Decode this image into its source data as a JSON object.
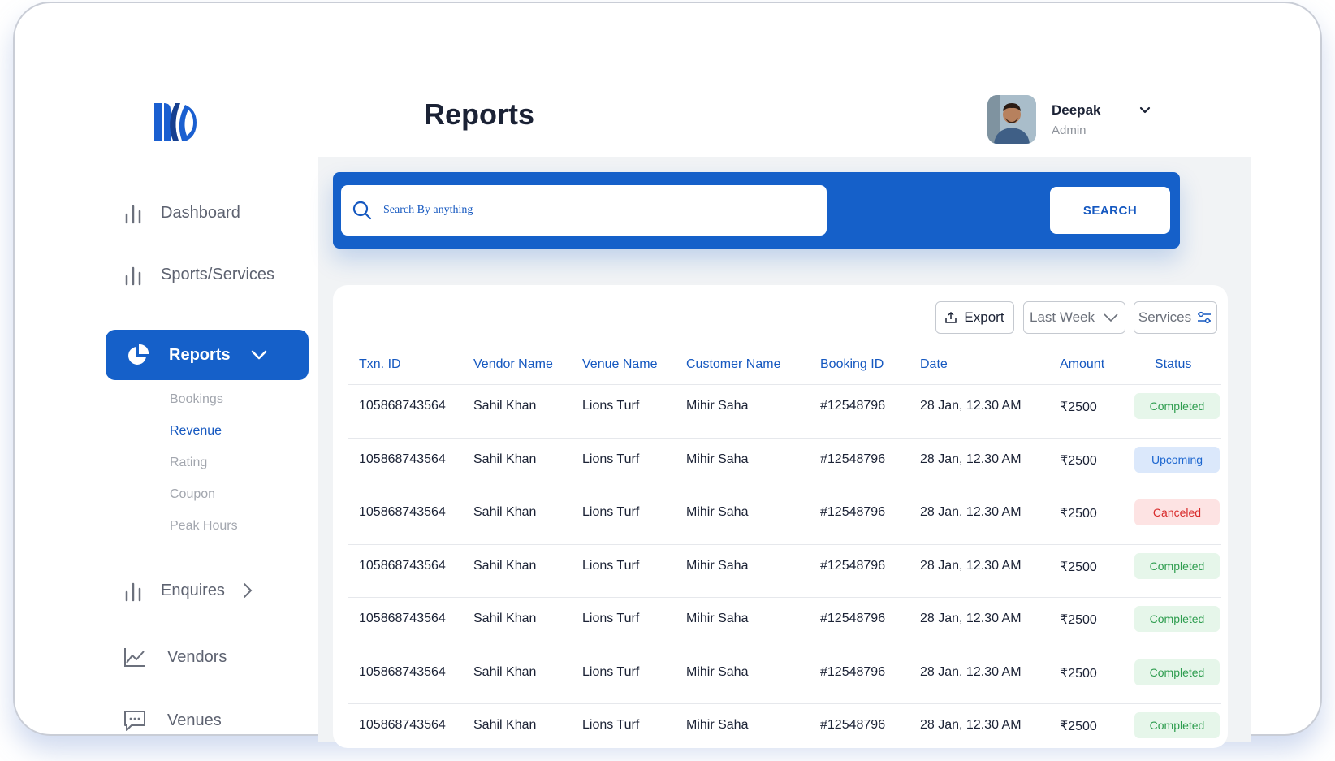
{
  "sidebar": {
    "items": [
      {
        "label": "Dashboard"
      },
      {
        "label": "Sports/Services"
      },
      {
        "label": "Reports"
      },
      {
        "label": "Enquires"
      },
      {
        "label": "Vendors"
      },
      {
        "label": "Venues"
      }
    ],
    "sub_items": [
      {
        "label": "Bookings"
      },
      {
        "label": "Revenue"
      },
      {
        "label": "Rating"
      },
      {
        "label": "Coupon"
      },
      {
        "label": "Peak Hours"
      }
    ],
    "active_item": "Reports",
    "active_sub_item": "Revenue"
  },
  "header": {
    "title": "Reports",
    "user": {
      "name": "Deepak",
      "role": "Admin"
    }
  },
  "search": {
    "placeholder": "Search By anything",
    "button_label": "SEARCH"
  },
  "toolbar": {
    "export_label": "Export",
    "period_label": "Last Week",
    "services_label": "Services"
  },
  "table": {
    "columns": [
      "Txn. ID",
      "Vendor Name",
      "Venue Name",
      "Customer Name",
      "Booking ID",
      "Date",
      "Amount",
      "Status"
    ],
    "rows": [
      {
        "txn": "105868743564",
        "vendor": "Sahil Khan",
        "venue": "Lions Turf",
        "customer": "Mihir Saha",
        "booking": "#12548796",
        "date": "28 Jan, 12.30 AM",
        "amount": "₹2500",
        "status": "Completed"
      },
      {
        "txn": "105868743564",
        "vendor": "Sahil Khan",
        "venue": "Lions Turf",
        "customer": "Mihir Saha",
        "booking": "#12548796",
        "date": "28 Jan, 12.30 AM",
        "amount": "₹2500",
        "status": "Upcoming"
      },
      {
        "txn": "105868743564",
        "vendor": "Sahil Khan",
        "venue": "Lions Turf",
        "customer": "Mihir Saha",
        "booking": "#12548796",
        "date": "28 Jan, 12.30 AM",
        "amount": "₹2500",
        "status": "Canceled"
      },
      {
        "txn": "105868743564",
        "vendor": "Sahil Khan",
        "venue": "Lions Turf",
        "customer": "Mihir Saha",
        "booking": "#12548796",
        "date": "28 Jan, 12.30 AM",
        "amount": "₹2500",
        "status": "Completed"
      },
      {
        "txn": "105868743564",
        "vendor": "Sahil Khan",
        "venue": "Lions Turf",
        "customer": "Mihir Saha",
        "booking": "#12548796",
        "date": "28 Jan, 12.30 AM",
        "amount": "₹2500",
        "status": "Completed"
      },
      {
        "txn": "105868743564",
        "vendor": "Sahil Khan",
        "venue": "Lions Turf",
        "customer": "Mihir Saha",
        "booking": "#12548796",
        "date": "28 Jan, 12.30 AM",
        "amount": "₹2500",
        "status": "Completed"
      },
      {
        "txn": "105868743564",
        "vendor": "Sahil Khan",
        "venue": "Lions Turf",
        "customer": "Mihir Saha",
        "booking": "#12548796",
        "date": "28 Jan, 12.30 AM",
        "amount": "₹2500",
        "status": "Completed"
      }
    ]
  },
  "colors": {
    "primary": "#1560c9",
    "link": "#1558c0",
    "completed": "#2e9d4f",
    "upcoming": "#1d67d0",
    "canceled": "#d82b2b"
  }
}
